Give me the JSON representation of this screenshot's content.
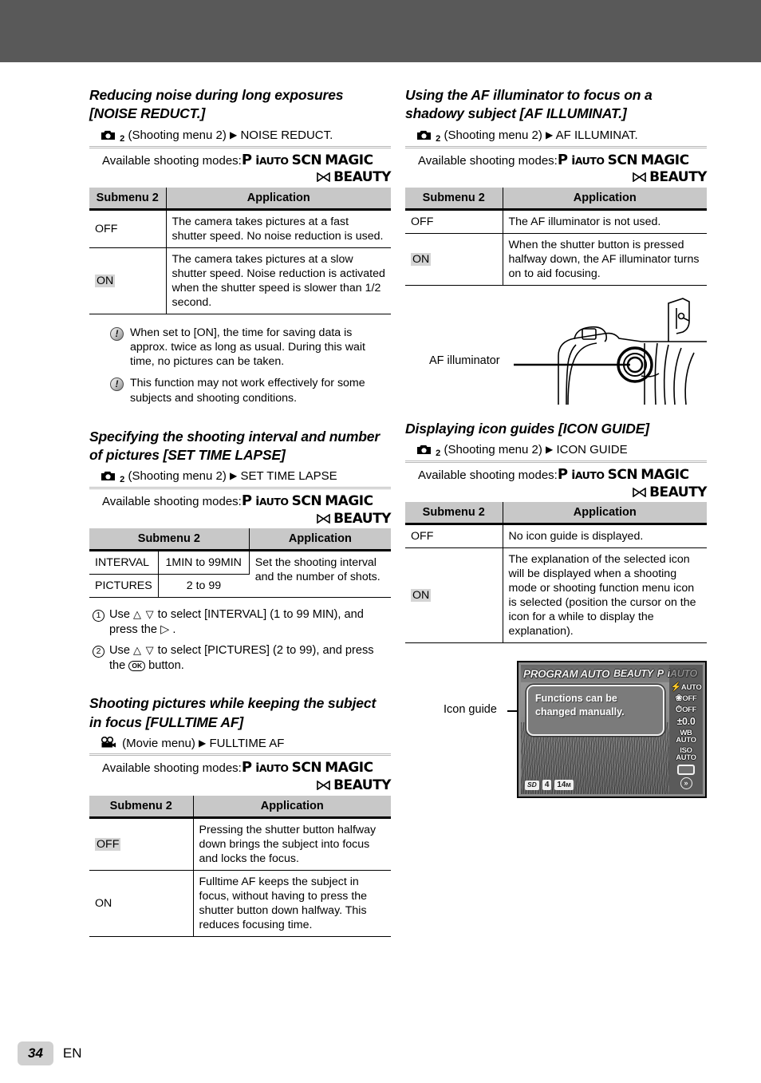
{
  "page": {
    "number": "34",
    "language": "EN"
  },
  "icons": {
    "camera_menu": "camera-icon",
    "movie_menu": "movie-camera-icon",
    "arrow_right": "right-triangle-icon",
    "note": "caution-icon"
  },
  "modes_label": "Available shooting modes:",
  "modes": {
    "p": "P",
    "iauto_i": "i",
    "iauto_rest": "AUTO",
    "scn": "SCN",
    "magic": "MAGIC",
    "beauty": "BEAUTY",
    "beauty_icon": "bowtie-icon"
  },
  "table_headers": {
    "submenu": "Submenu 2",
    "application": "Application"
  },
  "sections": {
    "noise_reduct": {
      "title": "Reducing noise during long exposures [NOISE REDUCT.]",
      "menu_name": "(Shooting menu 2)",
      "menu_sub": "2",
      "menu_target": "NOISE REDUCT.",
      "rows": [
        {
          "submenu": "OFF",
          "highlight": false,
          "application": "The camera takes pictures at a fast shutter speed. No noise reduction is used."
        },
        {
          "submenu": "ON",
          "highlight": true,
          "application": "The camera takes pictures at a slow shutter speed. Noise reduction is activated when the shutter speed is slower than 1/2 second."
        }
      ],
      "notes": [
        "When set to [ON], the time for saving data is approx. twice as long as usual. During this wait time, no pictures can be taken.",
        "This function may not work effectively for some subjects and shooting conditions."
      ]
    },
    "set_time_lapse": {
      "title": "Specifying the shooting interval and number of pictures [SET TIME LAPSE]",
      "menu_name": "(Shooting menu 2)",
      "menu_sub": "2",
      "menu_target": "SET TIME LAPSE",
      "rows": [
        {
          "submenu": "INTERVAL",
          "value": "1MIN to 99MIN"
        },
        {
          "submenu": "PICTURES",
          "value": "2 to 99"
        }
      ],
      "application": "Set the shooting interval and the number of shots.",
      "steps": [
        {
          "num": "1",
          "text_pre": "Use ",
          "keys": "△ ▽",
          "text_post": " to select [INTERVAL] (1 to 99 MIN), and press the ▷ ."
        },
        {
          "num": "2",
          "text_pre": "Use ",
          "keys": "△ ▽",
          "text_post": " to select [PICTURES] (2 to 99), and press the ",
          "ok": "OK",
          "text_end": " button."
        }
      ]
    },
    "fulltime_af": {
      "title": "Shooting pictures while keeping the subject in focus [FULLTIME AF]",
      "menu_name": "(Movie menu)",
      "menu_target": "FULLTIME AF",
      "rows": [
        {
          "submenu": "OFF",
          "highlight": true,
          "application": "Pressing the shutter button halfway down brings the subject into focus and locks the focus."
        },
        {
          "submenu": "ON",
          "highlight": false,
          "application": "Fulltime AF keeps the subject in focus, without having to press the shutter button down halfway. This reduces focusing time."
        }
      ]
    },
    "af_illuminat": {
      "title": "Using the AF illuminator to focus on a shadowy subject [AF ILLUMINAT.]",
      "menu_name": "(Shooting menu 2)",
      "menu_sub": "2",
      "menu_target": "AF ILLUMINAT.",
      "rows": [
        {
          "submenu": "OFF",
          "highlight": false,
          "application": "The AF illuminator is not used."
        },
        {
          "submenu": "ON",
          "highlight": true,
          "application": "When the shutter button is pressed halfway down, the AF illuminator turns on to aid focusing."
        }
      ],
      "illustration_label": "AF illuminator"
    },
    "icon_guide": {
      "title": "Displaying icon guides [ICON GUIDE]",
      "menu_name": "(Shooting menu 2)",
      "menu_sub": "2",
      "menu_target": "ICON GUIDE",
      "rows": [
        {
          "submenu": "OFF",
          "highlight": false,
          "application": "No icon guide is displayed."
        },
        {
          "submenu": "ON",
          "highlight": true,
          "application": "The explanation of the selected icon will be displayed when a shooting mode or shooting function menu icon is selected (position the cursor on the icon for a while to display the explanation)."
        }
      ],
      "screen_label": "Icon guide",
      "screen": {
        "mode_name": "PROGRAM AUTO",
        "mode_beauty": "BEAUTY",
        "mode_p": "P",
        "mode_iauto": "iAUTO",
        "guide_text": "Functions can be changed manually.",
        "side": [
          {
            "name": "flash-mode",
            "glyph": "⚡",
            "label": "AUTO"
          },
          {
            "name": "macro-mode",
            "glyph": "❀",
            "label": "OFF"
          },
          {
            "name": "self-timer",
            "glyph": "⏱",
            "label": "OFF"
          },
          {
            "name": "exposure-comp",
            "glyph": "",
            "label": "±0.0"
          },
          {
            "name": "white-balance",
            "glyph": "WB",
            "label": "AUTO"
          },
          {
            "name": "iso",
            "glyph": "ISO",
            "label": "AUTO"
          }
        ],
        "bottom": {
          "card": "SD",
          "shots": "4",
          "size_num": "14",
          "size_unit": "M"
        }
      }
    }
  }
}
